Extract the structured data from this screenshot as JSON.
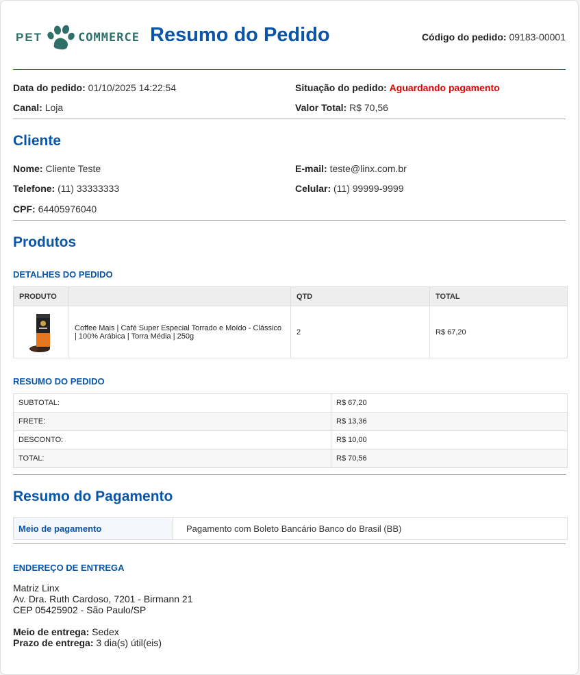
{
  "header": {
    "logo_left": "PET",
    "logo_right": "COMMERCE",
    "title": "Resumo do Pedido",
    "order_code_label": "Código do pedido:",
    "order_code": "09183-00001"
  },
  "order": {
    "date_label": "Data do pedido:",
    "date": "01/10/2025 14:22:54",
    "status_label": "Situação do pedido:",
    "status": "Aguardando pagamento",
    "channel_label": "Canal:",
    "channel": "Loja",
    "total_label": "Valor Total:",
    "total": "R$ 70,56"
  },
  "client": {
    "title": "Cliente",
    "name_label": "Nome:",
    "name": "Cliente Teste",
    "email_label": "E-mail:",
    "email": "teste@linx.com.br",
    "phone_label": "Telefone:",
    "phone": "(11) 33333333",
    "mobile_label": "Celular:",
    "mobile": "(11) 99999-9999",
    "cpf_label": "CPF:",
    "cpf": "64405976040"
  },
  "products": {
    "title": "Produtos",
    "details_title": "DETALHES DO PEDIDO",
    "headers": [
      "PRODUTO",
      "",
      "QTD",
      "TOTAL"
    ],
    "items": [
      {
        "name_line1": "Coffee Mais | Café Super Especial Torrado e Moído - Clássico",
        "name_line2": "| 100% Arábica | Torra Média | 250g",
        "qty": "2",
        "total": "R$ 67,20"
      }
    ]
  },
  "summary": {
    "title": "RESUMO DO PEDIDO",
    "rows": [
      {
        "label": "SUBTOTAL:",
        "value": "R$ 67,20"
      },
      {
        "label": "FRETE:",
        "value": "R$ 13,36"
      },
      {
        "label": "DESCONTO:",
        "value": "R$ 10,00"
      },
      {
        "label": "TOTAL:",
        "value": "R$ 70,56"
      }
    ]
  },
  "payment": {
    "title": "Resumo do Pagamento",
    "method_label": "Meio de pagamento",
    "method": "Pagamento com Boleto Bancário Banco do Brasil (BB)"
  },
  "delivery": {
    "title": "ENDEREÇO DE ENTREGA",
    "line1": "Matriz Linx",
    "line2": "Av. Dra. Ruth Cardoso, 7201 - Birmann 21",
    "line3": "CEP 05425902 - São Paulo/SP",
    "method_label": "Meio de entrega:",
    "method": "Sedex",
    "deadline_label": "Prazo de entrega:",
    "deadline": "3 dia(s) útil(eis)"
  },
  "colors": {
    "accent": "#0a55a8",
    "status": "#e00000",
    "logo": "#2f6f6a"
  }
}
